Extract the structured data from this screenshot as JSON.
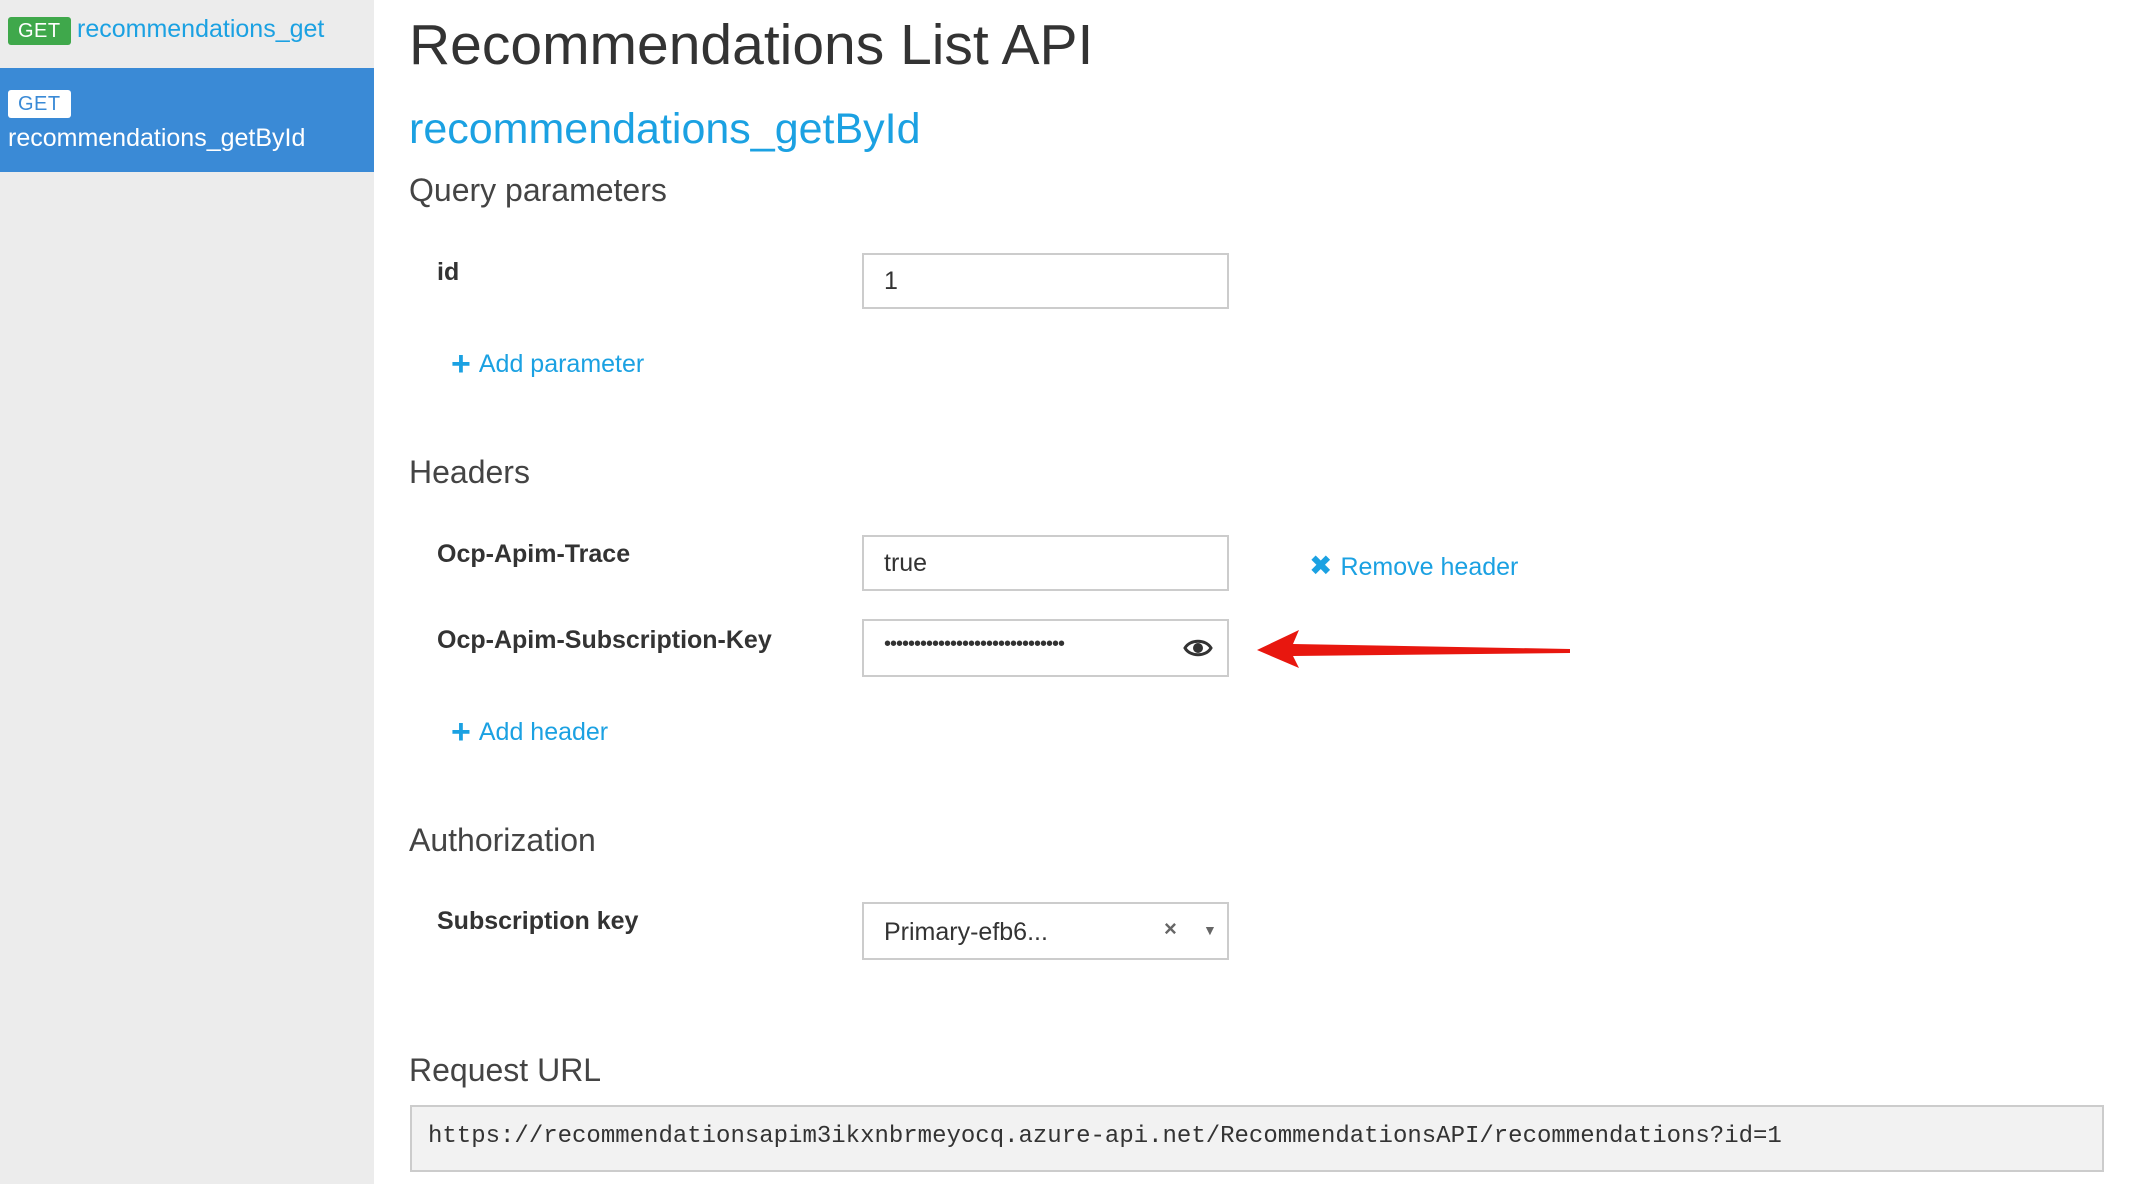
{
  "sidebar": {
    "items": [
      {
        "method": "GET",
        "label": "recommendations_get"
      },
      {
        "method": "GET",
        "label": "recommendations_getById"
      }
    ]
  },
  "main": {
    "title": "Recommendations List API",
    "operation_title": "recommendations_getById",
    "query_section": "Query parameters",
    "query_params": [
      {
        "name": "id",
        "value": "1"
      }
    ],
    "add_parameter": "Add parameter",
    "headers_section": "Headers",
    "headers": [
      {
        "name": "Ocp-Apim-Trace",
        "value": "true"
      },
      {
        "name": "Ocp-Apim-Subscription-Key",
        "masked_value": "••••••••••••••••••••••••••••••"
      }
    ],
    "remove_header": "Remove header",
    "add_header": "Add header",
    "authorization_section": "Authorization",
    "subscription_key_label": "Subscription key",
    "subscription_key_value": "Primary-efb6...",
    "request_url_section": "Request URL",
    "request_url": "https://recommendationsapim3ikxnbrmeyocq.azure-api.net/RecommendationsAPI/recommendations?id=1"
  },
  "colors": {
    "accent": "#1ba1e2",
    "active_bg": "#3a8ad6",
    "get_badge": "#3fa84b",
    "annotation_arrow": "#e8170f"
  },
  "icons": {
    "show_password": "eye-icon",
    "add": "plus-icon",
    "remove": "close-icon",
    "dropdown": "caret-down-icon",
    "annotation": "red-arrow"
  }
}
